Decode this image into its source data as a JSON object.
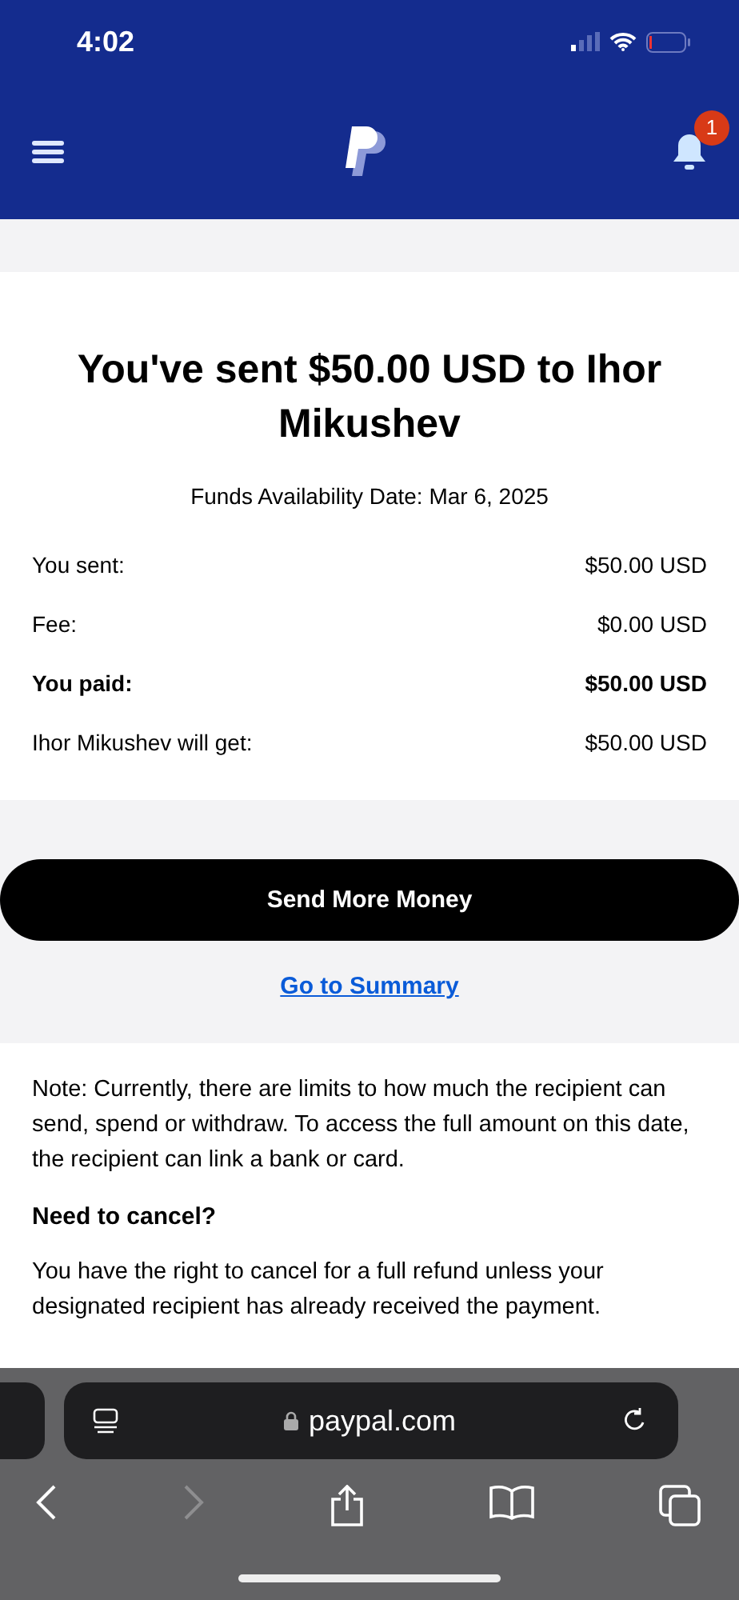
{
  "status_bar": {
    "time": "4:02"
  },
  "header": {
    "notification_count": "1"
  },
  "confirmation": {
    "title": "You've sent $50.00 USD to Ihor Mikushev",
    "availability": "Funds Availability Date: Mar 6, 2025",
    "rows": [
      {
        "label": "You sent:",
        "value": "$50.00 USD",
        "bold": false
      },
      {
        "label": "Fee:",
        "value": "$0.00 USD",
        "bold": false
      },
      {
        "label": "You paid:",
        "value": "$50.00 USD",
        "bold": true
      },
      {
        "label": "Ihor Mikushev will get:",
        "value": "$50.00 USD",
        "bold": false
      }
    ]
  },
  "actions": {
    "primary": "Send More Money",
    "link": "Go to Summary"
  },
  "notes": {
    "note": "Note: Currently, there are limits to how much the recipient can send, spend or withdraw. To access the full amount on this date, the recipient can link a bank or card.",
    "heading": "Need to cancel?",
    "paragraph": "You have the right to cancel for a full refund unless your designated recipient has already received the payment."
  },
  "browser": {
    "url": "paypal.com",
    "back_disabled": false,
    "forward_disabled": true
  }
}
